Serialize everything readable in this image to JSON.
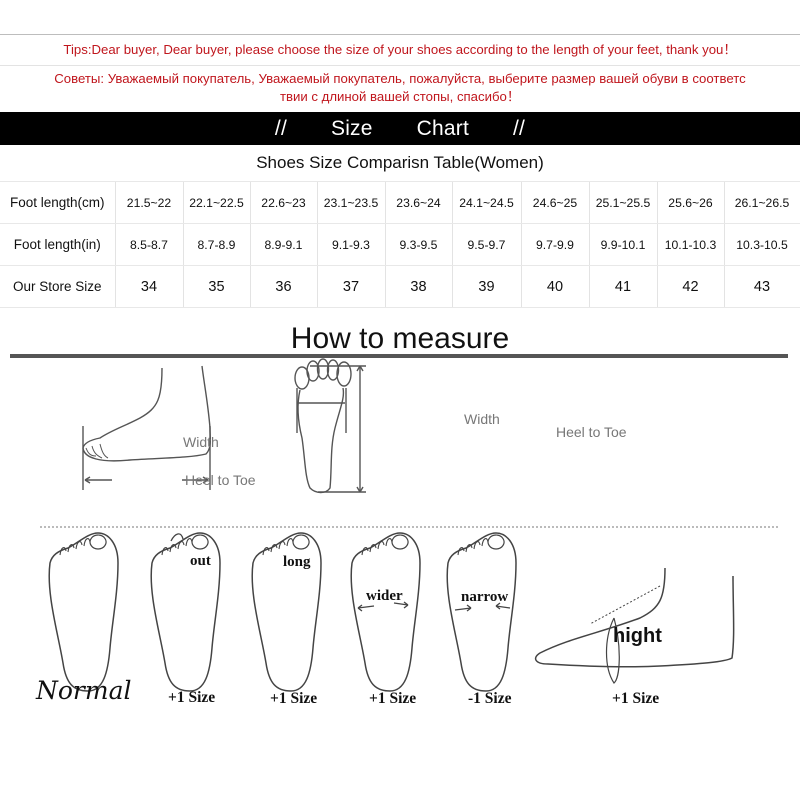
{
  "notice": {
    "tips_en": "Tips:Dear buyer, Dear buyer, please choose the size of your shoes according to the length of your feet, thank you！",
    "tips_ru_line1": "Советы: Уважаемый покупатель, Уважаемый покупатель, пожалуйста, выберите размер вашей обуви в соответс",
    "tips_ru_line2": "твии с длиной вашей стопы, спасибо！",
    "color": "#c0161d"
  },
  "banner": {
    "left_mark": "//",
    "word1": "Size",
    "word2": "Chart",
    "right_mark": "//"
  },
  "table": {
    "title": "Shoes Size Comparisn Table(Women)",
    "rows": [
      {
        "label": "Foot length(cm)",
        "values": [
          "21.5~22",
          "22.1~22.5",
          "22.6~23",
          "23.1~23.5",
          "23.6~24",
          "24.1~24.5",
          "24.6~25",
          "25.1~25.5",
          "25.6~26",
          "26.1~26.5"
        ]
      },
      {
        "label": "Foot length(in)",
        "values": [
          "8.5-8.7",
          "8.7-8.9",
          "8.9-9.1",
          "9.1-9.3",
          "9.3-9.5",
          "9.5-9.7",
          "9.7-9.9",
          "9.9-10.1",
          "10.1-10.3",
          "10.3-10.5"
        ]
      },
      {
        "label": "Our Store Size",
        "values": [
          "34",
          "35",
          "36",
          "37",
          "38",
          "39",
          "40",
          "41",
          "42",
          "43"
        ]
      }
    ]
  },
  "measure": {
    "title": "How to measure",
    "side_view": {
      "width_label": "Width",
      "length_label": "Heel to Toe"
    },
    "top_view": {
      "width_label": "Width",
      "length_label": "Heel to Toe"
    },
    "foot_types": [
      {
        "name": "Normal",
        "inner_label": "",
        "adjust": ""
      },
      {
        "name": "out",
        "inner_label": "out",
        "adjust": "+1 Size"
      },
      {
        "name": "long",
        "inner_label": "long",
        "adjust": "+1 Size"
      },
      {
        "name": "wider",
        "inner_label": "wider",
        "adjust": "+1 Size"
      },
      {
        "name": "narrow",
        "inner_label": "narrow",
        "adjust": "-1 Size"
      },
      {
        "name": "hight",
        "inner_label": "hight",
        "adjust": "+1 Size"
      }
    ],
    "normal_label": "Normal"
  }
}
